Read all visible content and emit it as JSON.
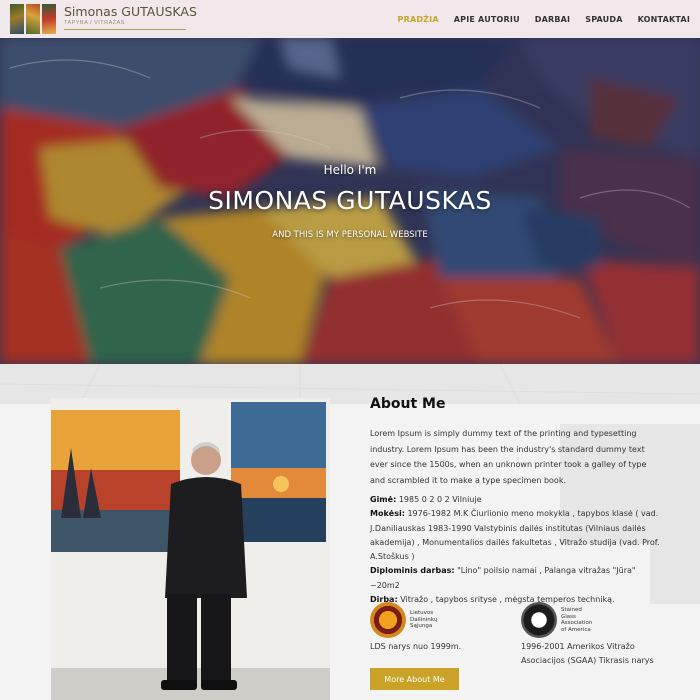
{
  "header": {
    "logo_name": "Simonas GUTAUSKAS",
    "logo_sub": "TAPYBA / VITRAŽAS",
    "nav": [
      {
        "label": "PRADŽIA",
        "active": true
      },
      {
        "label": "APIE AUTORIU",
        "active": false
      },
      {
        "label": "DARBAI",
        "active": false
      },
      {
        "label": "SPAUDA",
        "active": false
      },
      {
        "label": "KONTAKTAI",
        "active": false
      }
    ]
  },
  "hero": {
    "hello": "Hello I'm",
    "name": "SIMONAS GUTAUSKAS",
    "tagline": "AND THIS IS MY PERSONAL WEBSITE"
  },
  "about": {
    "title": "About Me",
    "intro": "Lorem Ipsum is simply dummy text of the printing and typesetting industry. Lorem Ipsum has been the industry's standard dummy text ever since the 1500s, when an unknown printer took a galley of type and scrambled it to make a type specimen book.",
    "facts": [
      {
        "label": "Gimė:",
        "text": " 1985  0 2   0 2  Vilniuje"
      },
      {
        "label": "Mokėsi:",
        "text": " 1976-1982 M.K Čiurlionio meno mokykla , tapybos klasė ( vad. J.Daniliauskas 1983-1990 Valstybinis dailės institutas (Vilniaus dailės akademija) , Monumentalios dailės fakultetas , Vitražo studija (vad. Prof. A.Stoškus )"
      },
      {
        "label": "Diplominis darbas:",
        "text": " \"Lino\" poilsio namai , Palanga vitražas \"Jūra\" ~20m2"
      },
      {
        "label": "Dirba:",
        "text": " Vitražo , tapybos srityse , mėgsta temperos techniką."
      }
    ],
    "org1": {
      "logo_text": "Lietuvos Dailininkų Sąjunga",
      "caption": "LDS narys nuo 1999m."
    },
    "org2": {
      "logo_text": "Stained Glass Association of America",
      "caption": "1996-2001 Amerikos Vitražo Asociacijos (SGAA) Tikrasis narys"
    },
    "button_label": "More About Me"
  },
  "colors": {
    "accent": "#c9a227",
    "header_bg": "#f1e8ec"
  }
}
